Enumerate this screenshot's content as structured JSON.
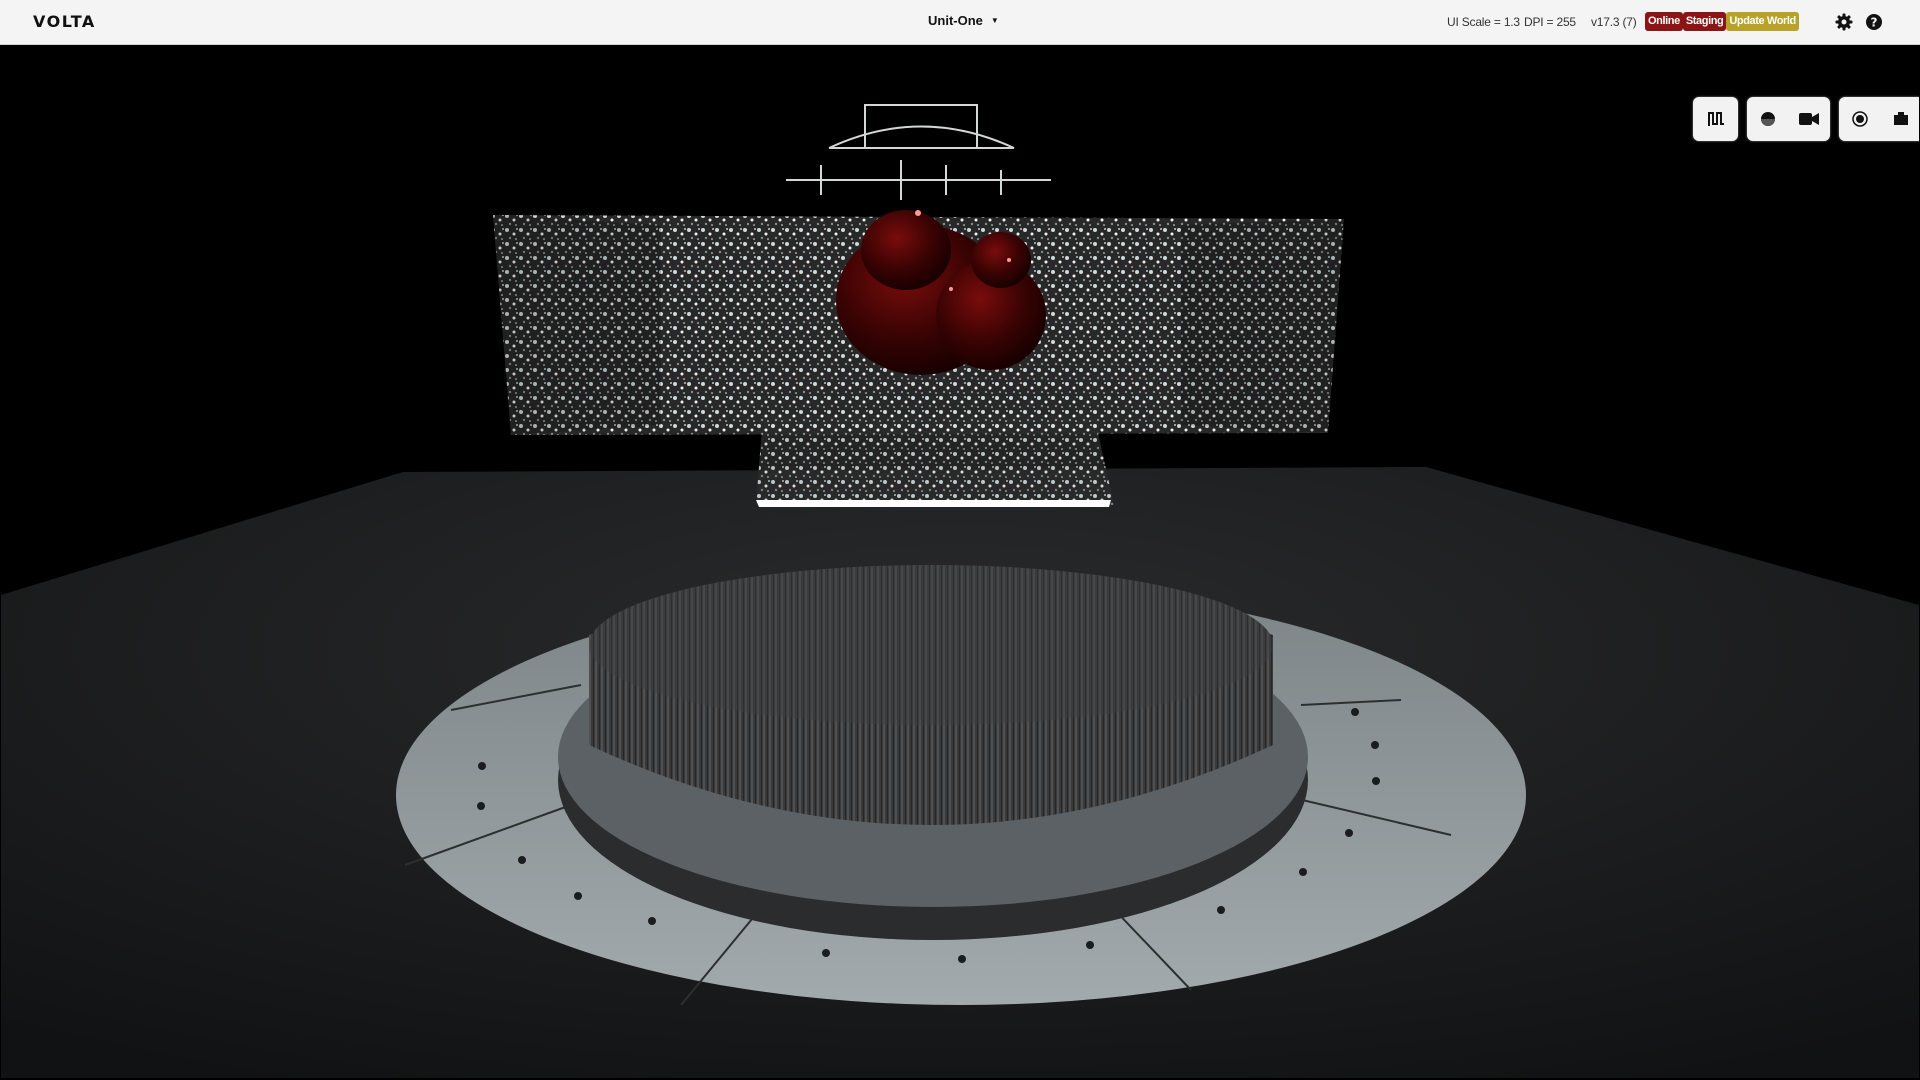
{
  "app": {
    "logo": "VOLTA"
  },
  "project": {
    "name": "Unit-One"
  },
  "status": {
    "ui_scale": "UI Scale = 1.3",
    "dpi": "DPI = 255",
    "version": "v17.3 (7)"
  },
  "badges": [
    {
      "label": "Online",
      "color": "#8b1515"
    },
    {
      "label": "Staging",
      "color": "#8b1515"
    },
    {
      "label": "Update World",
      "color": "#b8a22a"
    }
  ],
  "icons": {
    "settings": "gear-icon",
    "help": "help-icon",
    "graph": "graph-icon",
    "sphere": "sphere-icon",
    "camera": "camera-icon",
    "record": "record-icon",
    "capture": "capture-icon"
  },
  "colors": {
    "topbar": "#f4f4f4",
    "viewport_bg": "#000000",
    "floor": "#1e1f20",
    "ring": "#8f9699",
    "blob": "#4a0505"
  }
}
